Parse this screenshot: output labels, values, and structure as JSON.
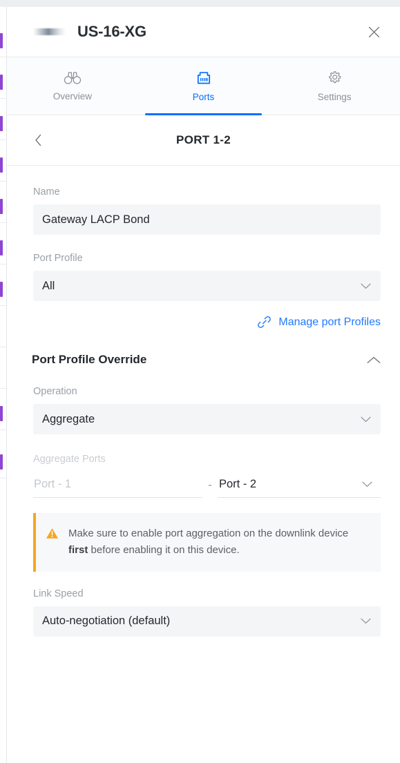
{
  "header": {
    "device_title": "US-16-XG",
    "device_thumb_icon": "switch-device-thumbnail",
    "close_icon": "close-icon"
  },
  "tabs": [
    {
      "label": "Overview",
      "icon": "binoculars-icon",
      "active": false
    },
    {
      "label": "Ports",
      "icon": "ethernet-port-icon",
      "active": true
    },
    {
      "label": "Settings",
      "icon": "gear-icon",
      "active": false
    }
  ],
  "sub_header": {
    "title": "PORT 1-2",
    "back_icon": "chevron-left-icon"
  },
  "form": {
    "name": {
      "label": "Name",
      "value": "Gateway LACP Bond"
    },
    "port_profile": {
      "label": "Port Profile",
      "value": "All",
      "chevron_icon": "chevron-down-icon"
    },
    "manage_link": {
      "label": "Manage port Profiles",
      "icon": "link-chain-icon"
    }
  },
  "override": {
    "title": "Port Profile Override",
    "collapse_icon": "chevron-up-icon",
    "operation": {
      "label": "Operation",
      "value": "Aggregate",
      "chevron_icon": "chevron-down-icon"
    },
    "aggregate_ports": {
      "label": "Aggregate Ports",
      "port_a_value": "Port - 1",
      "separator": "-",
      "port_b_value": "Port - 2",
      "chevron_icon": "chevron-down-icon"
    },
    "warning": {
      "icon": "warning-triangle-icon",
      "text_before": "Make sure to enable port aggregation on the downlink device ",
      "text_bold": "first",
      "text_after": " before enabling it on this device."
    },
    "link_speed": {
      "label": "Link Speed",
      "value": "Auto-negotiation (default)",
      "chevron_icon": "chevron-down-icon"
    }
  },
  "colors": {
    "accent_blue": "#006fff",
    "link_blue": "#1f7aff",
    "warning_orange": "#f5a623",
    "field_bg": "#f4f5f7",
    "label_grey": "#9aa0a6",
    "bg_list_purple": "#8f44d4"
  }
}
